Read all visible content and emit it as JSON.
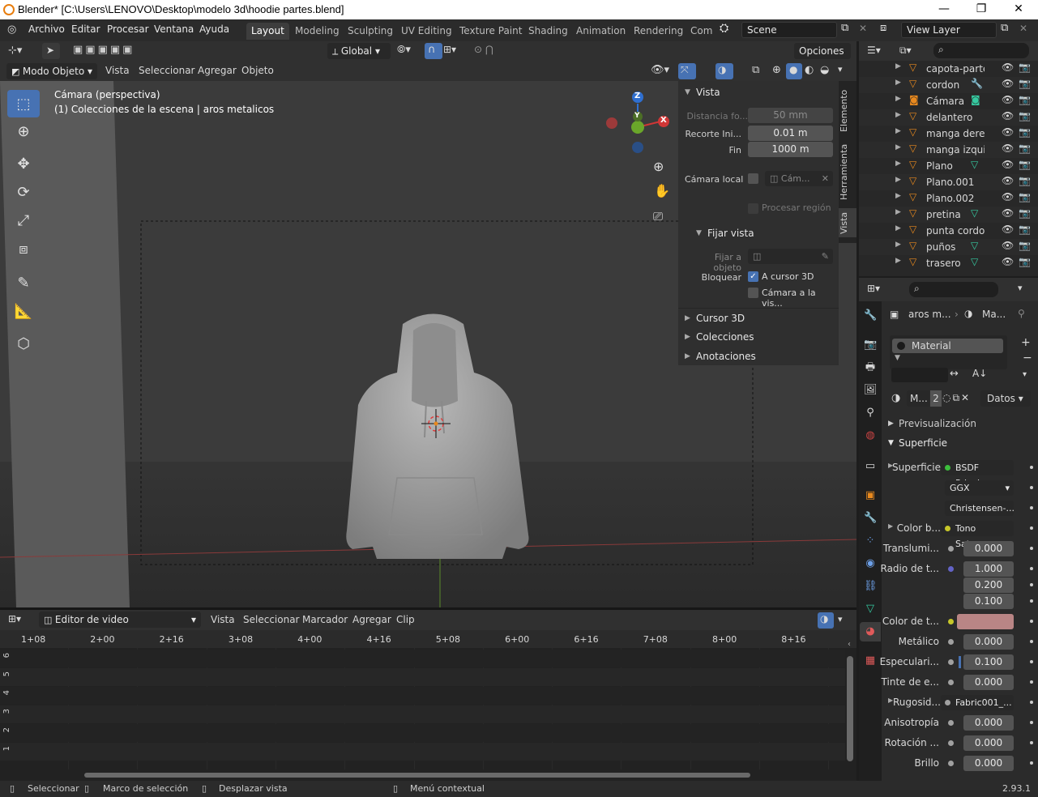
{
  "window": {
    "title": "Blender* [C:\\Users\\LENOVO\\Desktop\\modelo 3d\\hoodie partes.blend]",
    "min": "—",
    "max": "❐",
    "close": "✕"
  },
  "menu": [
    "Archivo",
    "Editar",
    "Procesar",
    "Ventana",
    "Ayuda"
  ],
  "workspaces": [
    "Layout",
    "Modeling",
    "Sculpting",
    "UV Editing",
    "Texture Paint",
    "Shading",
    "Animation",
    "Rendering",
    "Com"
  ],
  "scene": "Scene",
  "view_layer": "View Layer",
  "viewport": {
    "transform_orientation": "Global",
    "options": "Opciones",
    "mode": "Modo Objeto",
    "menus": [
      "Vista",
      "Seleccionar",
      "Agregar",
      "Objeto"
    ],
    "overlay_line1": "Cámara (perspectiva)",
    "overlay_line2": "(1) Colecciones de la escena | aros metalicos",
    "gizmo": {
      "z": "Z",
      "y": "Y",
      "x": "X"
    }
  },
  "npanel": {
    "tabs": [
      "Elemento",
      "Herramienta",
      "Vista"
    ],
    "vista_header": "Vista",
    "focal_label": "Distancia fo...",
    "focal_value": "50 mm",
    "clip_start_label": "Recorte  Ini...",
    "clip_start_value": "0.01 m",
    "clip_end_label": "Fin",
    "clip_end_value": "1000 m",
    "local_camera_label": "Cámara local",
    "local_camera_value": "Cám...",
    "render_region": "Procesar región",
    "lock_header": "Fijar vista",
    "lock_object_label": "Fijar a objeto",
    "lock_label": "Bloquear",
    "lock_cursor": "A cursor 3D",
    "lock_camera": "Cámara a la vis...",
    "collapsed": [
      "Cursor 3D",
      "Colecciones",
      "Anotaciones"
    ]
  },
  "outliner": {
    "items": [
      {
        "name": "capota-parte-l",
        "mod": ""
      },
      {
        "name": "cordon",
        "mod": "wrench"
      },
      {
        "name": "Cámara",
        "mod": "camera"
      },
      {
        "name": "delantero",
        "mod": ""
      },
      {
        "name": "manga derecl",
        "mod": ""
      },
      {
        "name": "manga izquiei",
        "mod": ""
      },
      {
        "name": "Plano",
        "mod": "mesh"
      },
      {
        "name": "Plano.001",
        "mod": ""
      },
      {
        "name": "Plano.002",
        "mod": ""
      },
      {
        "name": "pretina",
        "mod": "mesh"
      },
      {
        "name": "punta cordon",
        "mod": ""
      },
      {
        "name": "puños",
        "mod": "mesh"
      },
      {
        "name": "trasero",
        "mod": "mesh"
      }
    ]
  },
  "properties": {
    "breadcrumb_obj": "aros m...",
    "breadcrumb_mat": "Ma...",
    "slot": "Material",
    "mat_name": "M...",
    "users": "2",
    "link": "Datos",
    "preview": "Previsualización",
    "surface_header": "Superficie",
    "rows": [
      {
        "label": "Superficie",
        "value": "BSDF Princi...",
        "kind": "link",
        "sock": "#3cbe3c"
      },
      {
        "label": "",
        "value": "GGX",
        "kind": "select"
      },
      {
        "label": "",
        "value": "Christensen-...",
        "kind": "select"
      },
      {
        "label": "Color b...",
        "value": "Tono Satura...",
        "kind": "link",
        "sock": "#c7c729"
      },
      {
        "label": "Translumi...",
        "value": "0.000",
        "kind": "num",
        "sock": "#a1a1a1"
      },
      {
        "label": "Radio de t...",
        "value": "1.000",
        "kind": "num",
        "sock": "#6363c7"
      },
      {
        "label": "",
        "value": "0.200",
        "kind": "num"
      },
      {
        "label": "",
        "value": "0.100",
        "kind": "num"
      },
      {
        "label": "Color de t...",
        "value": "",
        "kind": "color",
        "sock": "#c7c729",
        "color": "#b98585"
      },
      {
        "label": "Metálico",
        "value": "0.000",
        "kind": "num",
        "sock": "#a1a1a1"
      },
      {
        "label": "Especulari...",
        "value": "0.100",
        "kind": "num",
        "sock": "#a1a1a1"
      },
      {
        "label": "Tinte de e...",
        "value": "0.000",
        "kind": "num",
        "sock": "#a1a1a1"
      },
      {
        "label": "Rugosid...",
        "value": "Fabric001_...",
        "kind": "link",
        "sock": "#a1a1a1"
      },
      {
        "label": "Anisotropía",
        "value": "0.000",
        "kind": "num",
        "sock": "#a1a1a1"
      },
      {
        "label": "Rotación ...",
        "value": "0.000",
        "kind": "num",
        "sock": "#a1a1a1"
      },
      {
        "label": "Brillo",
        "value": "0.000",
        "kind": "num",
        "sock": "#a1a1a1"
      }
    ]
  },
  "sequencer": {
    "editor": "Editor de video",
    "menus": [
      "Vista",
      "Seleccionar",
      "Marcador",
      "Agregar",
      "Clip"
    ],
    "timecodes": [
      "1+08",
      "2+00",
      "2+16",
      "3+08",
      "4+00",
      "4+16",
      "5+08",
      "6+00",
      "6+16",
      "7+08",
      "8+00",
      "8+16"
    ],
    "channels": [
      "6",
      "5",
      "4",
      "3",
      "2",
      "1"
    ]
  },
  "status": {
    "select": "Seleccionar",
    "box": "Marco de selección",
    "pan": "Desplazar vista",
    "context": "Menú contextual",
    "version": "2.93.1"
  },
  "colors": {
    "accent": "#4772b3",
    "object_orange": "#e8891e",
    "mesh_green": "#36c9a0"
  }
}
